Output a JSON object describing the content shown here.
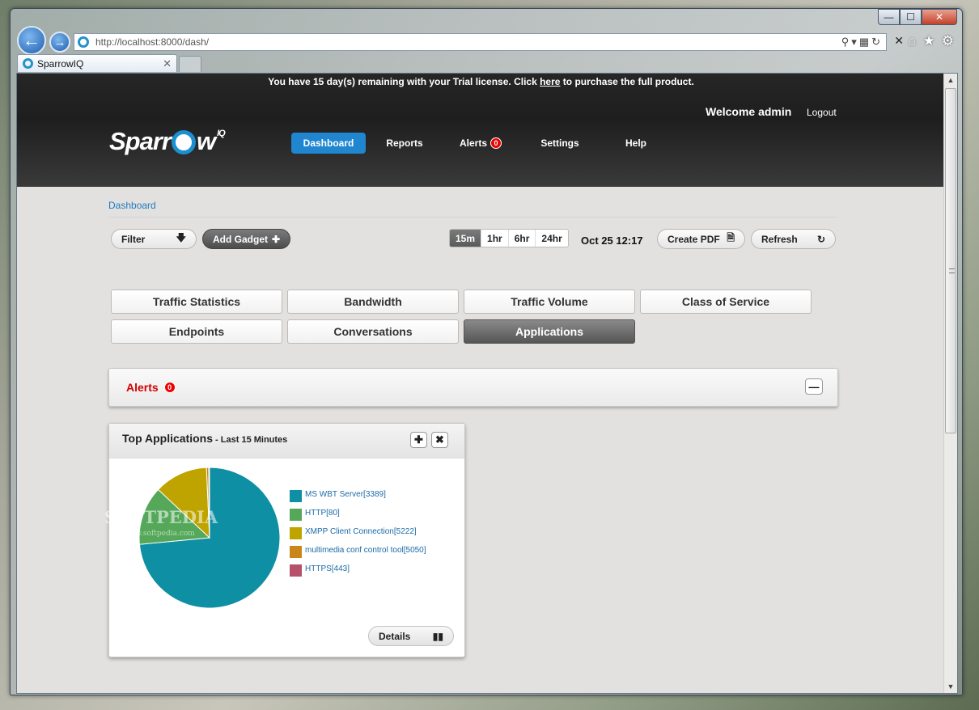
{
  "browser": {
    "url": "http://localhost:8000/dash/",
    "tab_title": "SparrowIQ",
    "tab_close": "✕",
    "address_close": "✕",
    "window_controls": {
      "minimize": "—",
      "maximize": "☐",
      "close": "✕"
    }
  },
  "banner": {
    "prefix": "You have 15 day(s) remaining with your Trial license. Click ",
    "link": "here",
    "suffix": " to purchase the full product."
  },
  "header": {
    "welcome": "Welcome admin",
    "logout": "Logout",
    "logo_text_1": "Sparr",
    "logo_text_2": "w",
    "logo_sup": "IQ"
  },
  "nav": {
    "dashboard": "Dashboard",
    "reports": "Reports",
    "alerts": "Alerts",
    "alerts_count": "0",
    "settings": "Settings",
    "help": "Help"
  },
  "breadcrumb": "Dashboard",
  "toolbar": {
    "filter": "Filter",
    "add_gadget": "Add Gadget",
    "ranges": [
      "15m",
      "1hr",
      "6hr",
      "24hr"
    ],
    "selected_range": "15m",
    "datetime": "Oct 25 12:17",
    "create_pdf": "Create PDF",
    "refresh": "Refresh"
  },
  "view_tabs": [
    "Traffic Statistics",
    "Bandwidth",
    "Traffic Volume",
    "Class of Service",
    "Endpoints",
    "Conversations",
    "Applications"
  ],
  "active_view_tab": "Applications",
  "alerts_panel": {
    "label": "Alerts",
    "count": "0"
  },
  "gadget": {
    "title": "Top Applications",
    "subtitle": " - Last 15 Minutes",
    "details": "Details"
  },
  "chart_data": {
    "type": "pie",
    "slices": [
      {
        "label": "MS WBT Server[3389]",
        "value": 73.5,
        "color": "#0e8fa3"
      },
      {
        "label": "HTTP[80]",
        "value": 13.5,
        "color": "#55a85a"
      },
      {
        "label": "XMPP Client Connection[5222]",
        "value": 12.3,
        "color": "#bfa400"
      },
      {
        "label": "multimedia conf control tool[5050]",
        "value": 0.5,
        "color": "#c8861b"
      },
      {
        "label": "HTTPS[443]",
        "value": 0.2,
        "color": "#b5516a"
      }
    ]
  },
  "watermark": {
    "title": "SOFTPEDIA",
    "url": "www.softpedia.com"
  }
}
